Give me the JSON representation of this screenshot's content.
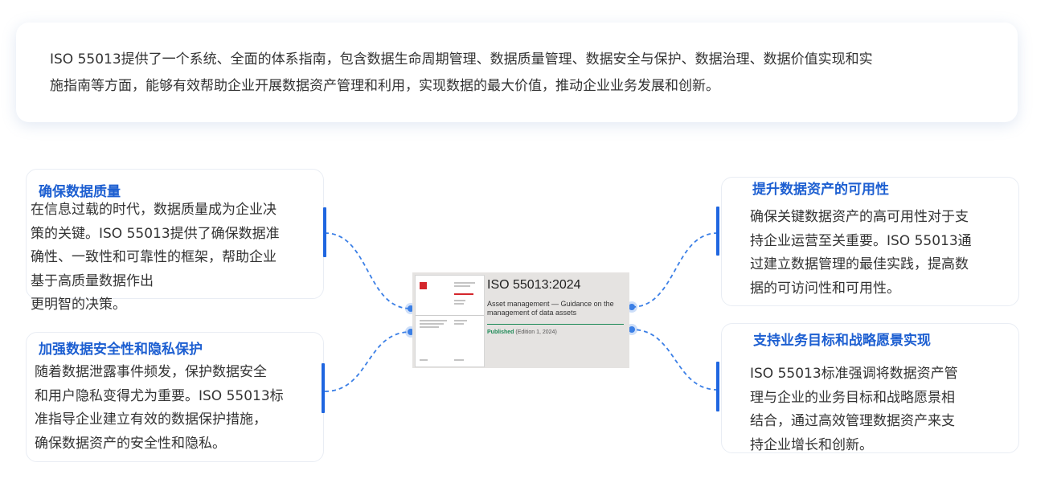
{
  "intro": {
    "line1": "ISO 55013提供了一个系统、全面的体系指南，包含数据生命周期管理、数据质量管理、数据安全与保护、数据治理、数据价值实现和实",
    "line2": "施指南等方面，能够有效帮助企业开展数据资产管理和利用，实现数据的最大价值，推动企业业务发展和创新。"
  },
  "cards": [
    {
      "title": "确保数据质量",
      "lines": [
        "在信息过载的时代，数据质量成为企业决",
        "策的关键。ISO  55013提供了确保数据准",
        "确性、一致性和可靠性的框架，帮助企业",
        "基于高质量数据作出",
        "更明智的决策。"
      ]
    },
    {
      "title": "加强数据安全性和隐私保护",
      "lines": [
        "随着数据泄露事件频发，保护数据安全",
        "和用户隐私变得尤为重要。ISO  55013标",
        "准指导企业建立有效的数据保护措施，",
        "确保数据资产的安全性和隐私。"
      ]
    },
    {
      "title": "提升数据资产的可用性",
      "lines": [
        "确保关键数据资产的高可用性对于支",
        "持企业运营至关重要。ISO    55013通",
        "过建立数据管理的最佳实践，提高数",
        "据的可访问性和可用性。"
      ]
    },
    {
      "title": "支持业务目标和战略愿景实现",
      "lines": [
        "ISO     55013标准强调将数据资产管",
        "理与企业的业务目标和战略愿景相",
        "结合，通过高效管理数据资产来支",
        "持企业增长和创新。"
      ]
    }
  ],
  "center": {
    "title": "ISO 55013:2024",
    "subtitle": "Asset management — Guidance on the management of data assets",
    "status": "Published",
    "edition": "(Edition 1, 2024)"
  },
  "colors": {
    "accent": "#1f66e0",
    "title": "#1d5fd1",
    "connector": "#3b7fe6"
  }
}
